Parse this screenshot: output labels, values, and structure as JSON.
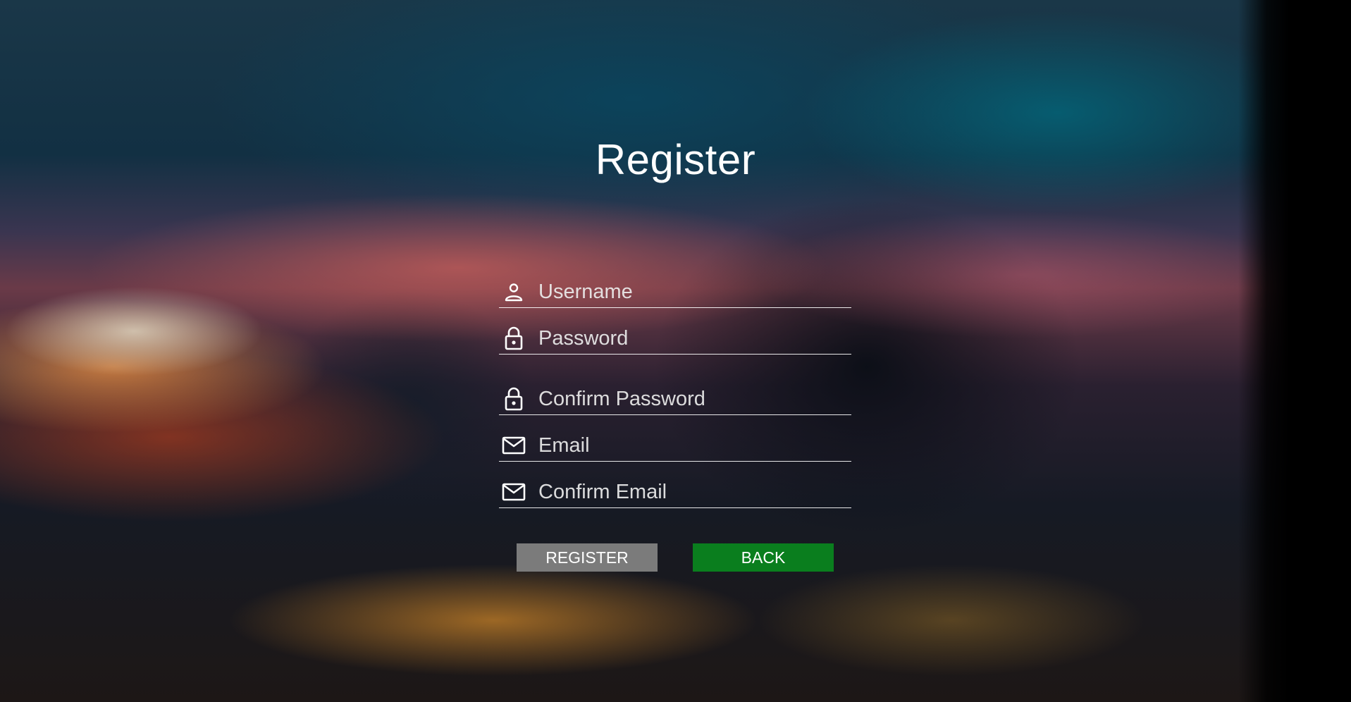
{
  "page": {
    "title": "Register"
  },
  "form": {
    "fields": [
      {
        "icon": "user-icon",
        "placeholder": "Username",
        "value": ""
      },
      {
        "icon": "lock-icon",
        "placeholder": "Password",
        "value": ""
      },
      {
        "icon": "lock-icon",
        "placeholder": "Confirm Password",
        "value": ""
      },
      {
        "icon": "mail-icon",
        "placeholder": "Email",
        "value": ""
      },
      {
        "icon": "mail-icon",
        "placeholder": "Confirm Email",
        "value": ""
      }
    ]
  },
  "buttons": {
    "register_label": "REGISTER",
    "back_label": "BACK"
  },
  "colors": {
    "register_button": "#7b7b7b",
    "back_button": "#0a7e1e",
    "text": "#ffffff"
  }
}
